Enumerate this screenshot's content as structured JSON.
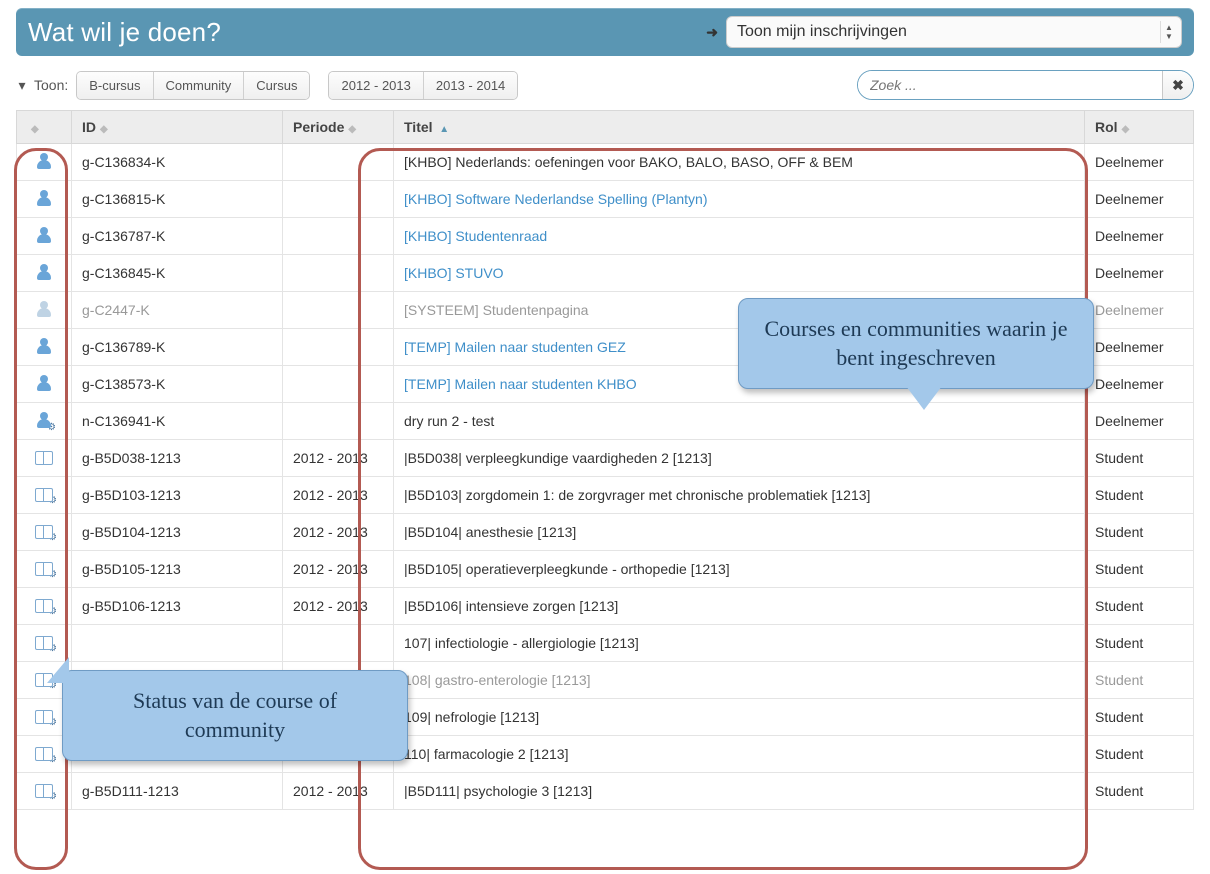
{
  "header": {
    "title": "Wat wil je doen?",
    "action_label": "Toon mijn inschrijvingen"
  },
  "filter": {
    "label": "Toon:",
    "types": [
      "B-cursus",
      "Community",
      "Cursus"
    ],
    "years": [
      "2012 - 2013",
      "2013 - 2014"
    ]
  },
  "search": {
    "placeholder": "Zoek ..."
  },
  "columns": {
    "id": "ID",
    "periode": "Periode",
    "titel": "Titel",
    "rol": "Rol"
  },
  "rows": [
    {
      "icon": "person",
      "id": "g-C136834-K",
      "periode": "",
      "titel": "[KHBO] Nederlands: oefeningen voor BAKO, BALO, BASO, OFF & BEM",
      "is_link": false,
      "rol": "Deelnemer",
      "muted": false
    },
    {
      "icon": "person",
      "id": "g-C136815-K",
      "periode": "",
      "titel": "[KHBO] Software Nederlandse Spelling (Plantyn)",
      "is_link": true,
      "rol": "Deelnemer",
      "muted": false
    },
    {
      "icon": "person",
      "id": "g-C136787-K",
      "periode": "",
      "titel": "[KHBO] Studentenraad",
      "is_link": true,
      "rol": "Deelnemer",
      "muted": false
    },
    {
      "icon": "person",
      "id": "g-C136845-K",
      "periode": "",
      "titel": "[KHBO] STUVO",
      "is_link": true,
      "rol": "Deelnemer",
      "muted": false
    },
    {
      "icon": "person",
      "id": "g-C2447-K",
      "periode": "",
      "titel": "[SYSTEEM] Studentenpagina",
      "is_link": false,
      "rol": "Deelnemer",
      "muted": true
    },
    {
      "icon": "person",
      "id": "g-C136789-K",
      "periode": "",
      "titel": "[TEMP] Mailen naar studenten GEZ",
      "is_link": true,
      "rol": "Deelnemer",
      "muted": false
    },
    {
      "icon": "person",
      "id": "g-C138573-K",
      "periode": "",
      "titel": "[TEMP] Mailen naar studenten KHBO",
      "is_link": true,
      "rol": "Deelnemer",
      "muted": false
    },
    {
      "icon": "person-gear",
      "id": "n-C136941-K",
      "periode": "",
      "titel": "dry run 2 - test",
      "is_link": false,
      "rol": "Deelnemer",
      "muted": false
    },
    {
      "icon": "book",
      "id": "g-B5D038-1213",
      "periode": "2012 - 2013",
      "titel": "|B5D038| verpleegkundige vaardigheden 2 [1213]",
      "is_link": false,
      "rol": "Student",
      "muted": false
    },
    {
      "icon": "book-gear",
      "id": "g-B5D103-1213",
      "periode": "2012 - 2013",
      "titel": "|B5D103| zorgdomein 1: de zorgvrager met chronische problematiek [1213]",
      "is_link": false,
      "rol": "Student",
      "muted": false
    },
    {
      "icon": "book-gear",
      "id": "g-B5D104-1213",
      "periode": "2012 - 2013",
      "titel": "|B5D104| anesthesie [1213]",
      "is_link": false,
      "rol": "Student",
      "muted": false
    },
    {
      "icon": "book-gear",
      "id": "g-B5D105-1213",
      "periode": "2012 - 2013",
      "titel": "|B5D105| operatieverpleegkunde - orthopedie [1213]",
      "is_link": false,
      "rol": "Student",
      "muted": false
    },
    {
      "icon": "book-gear",
      "id": "g-B5D106-1213",
      "periode": "2012 - 2013",
      "titel": "|B5D106| intensieve zorgen [1213]",
      "is_link": false,
      "rol": "Student",
      "muted": false
    },
    {
      "icon": "book-gear",
      "id": "",
      "periode": "",
      "titel": "107| infectiologie - allergiologie [1213]",
      "is_link": false,
      "rol": "Student",
      "muted": false
    },
    {
      "icon": "book-gear",
      "id": "",
      "periode": "",
      "titel": "108| gastro-enterologie [1213]",
      "is_link": false,
      "rol": "Student",
      "muted": true
    },
    {
      "icon": "book-gear",
      "id": "",
      "periode": "",
      "titel": "109| nefrologie [1213]",
      "is_link": false,
      "rol": "Student",
      "muted": false
    },
    {
      "icon": "book-gear",
      "id": "",
      "periode": "",
      "titel": "110| farmacologie 2 [1213]",
      "is_link": false,
      "rol": "Student",
      "muted": false
    },
    {
      "icon": "book-gear",
      "id": "g-B5D111-1213",
      "periode": "2012 - 2013",
      "titel": "|B5D111| psychologie 3 [1213]",
      "is_link": false,
      "rol": "Student",
      "muted": false
    }
  ],
  "callouts": {
    "big": "Courses en communities waarin je bent ingeschreven",
    "small": "Status van de course of community"
  }
}
